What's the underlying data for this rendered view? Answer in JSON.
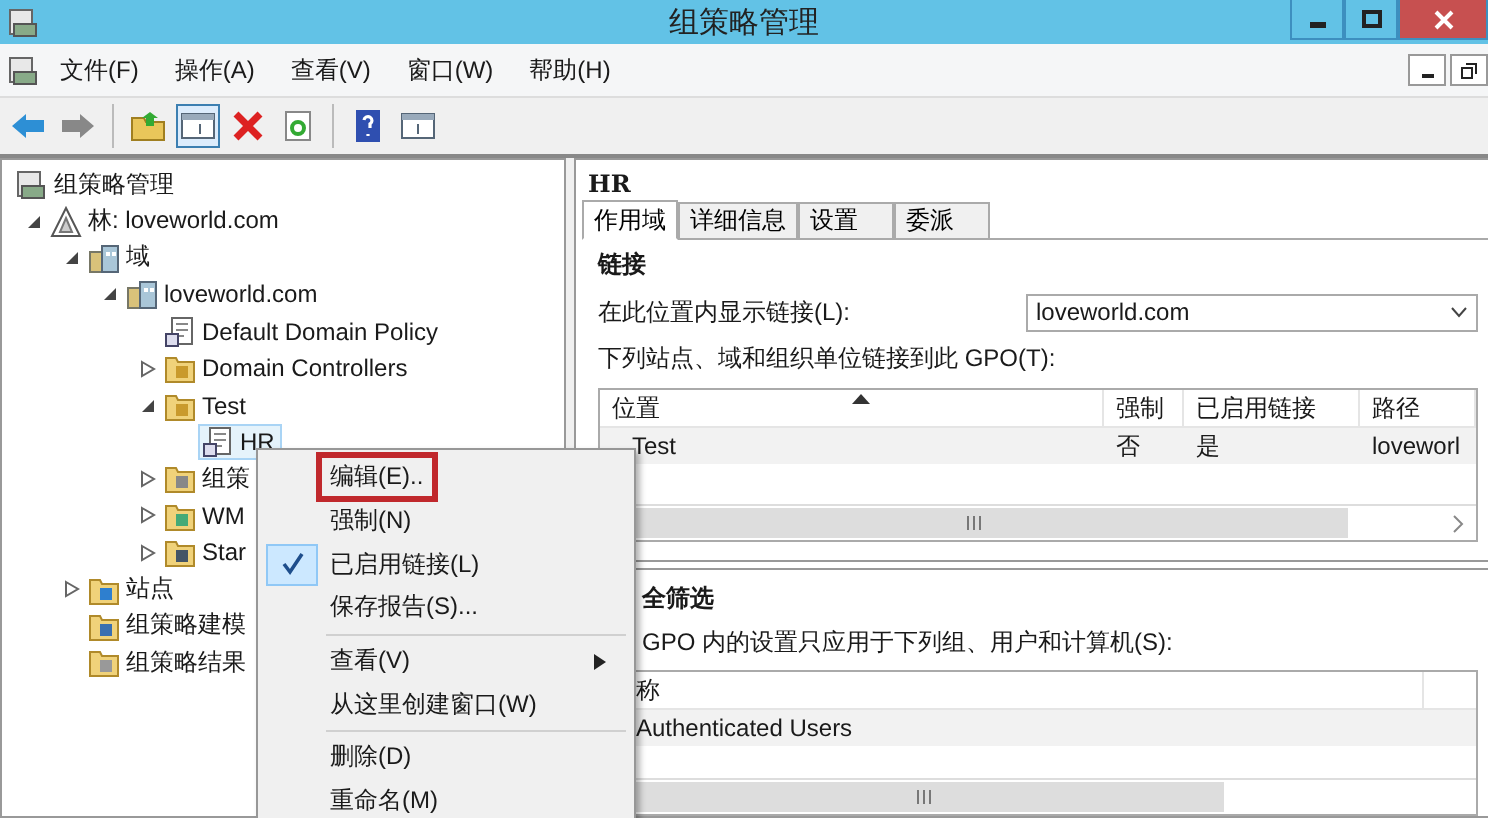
{
  "window": {
    "title": "组策略管理"
  },
  "menu_bar": [
    "文件(F)",
    "操作(A)",
    "查看(V)",
    "窗口(W)",
    "帮助(H)"
  ],
  "toolbar": [
    {
      "kind": "back",
      "pressed": false
    },
    {
      "kind": "forward",
      "pressed": false
    },
    {
      "kind": "separator"
    },
    {
      "kind": "up",
      "pressed": false
    },
    {
      "kind": "tree",
      "pressed": true
    },
    {
      "kind": "delete",
      "pressed": false
    },
    {
      "kind": "refresh",
      "pressed": false
    },
    {
      "kind": "separator"
    },
    {
      "kind": "help",
      "pressed": false
    },
    {
      "kind": "pane",
      "pressed": false
    }
  ],
  "tree": [
    {
      "label": "组策略管理",
      "kind": "console",
      "selected": false,
      "children": [
        {
          "label": "林: loveworld.com",
          "kind": "forest",
          "expanded": true,
          "selected": false,
          "children": [
            {
              "label": "域",
              "kind": "domains",
              "expanded": true,
              "selected": false,
              "children": [
                {
                  "label": "loveworld.com",
                  "kind": "domain",
                  "expanded": true,
                  "selected": false,
                  "children": [
                    {
                      "label": "Default Domain Policy",
                      "kind": "gpo",
                      "selected": false
                    },
                    {
                      "label": "Domain Controllers",
                      "kind": "ou",
                      "expanded": false,
                      "selected": false
                    },
                    {
                      "label": "Test",
                      "kind": "ou",
                      "expanded": true,
                      "selected": false,
                      "children": [
                        {
                          "label": "HR",
                          "kind": "gpo",
                          "selected": true
                        }
                      ]
                    },
                    {
                      "label": "组策",
                      "kind": "gpo-folder",
                      "expanded": false,
                      "selected": false
                    },
                    {
                      "label": "WM",
                      "kind": "filter-folder",
                      "expanded": false,
                      "selected": false
                    },
                    {
                      "label": "Star",
                      "kind": "starter-folder",
                      "expanded": false,
                      "selected": false
                    }
                  ]
                }
              ]
            },
            {
              "label": "站点",
              "kind": "sites",
              "expanded": false,
              "selected": false
            },
            {
              "label": "组策略建模",
              "kind": "modeling",
              "selected": false
            },
            {
              "label": "组策略结果",
              "kind": "results",
              "selected": false
            }
          ]
        }
      ]
    }
  ],
  "details": {
    "title": "HR",
    "tabs": [
      {
        "label": "作用域",
        "selected": true
      },
      {
        "label": "详细信息",
        "selected": false
      },
      {
        "label": "设置",
        "selected": false
      },
      {
        "label": "委派",
        "selected": false
      }
    ],
    "links": {
      "heading": "链接",
      "location_label": "在此位置内显示链接(L):",
      "location": "loveworld.com",
      "table_label": "下列站点、域和组织单位链接到此 GPO(T):",
      "columns": [
        {
          "label": "位置",
          "sorted": true
        },
        {
          "label": "强制",
          "sorted": false
        },
        {
          "label": "已启用链接",
          "sorted": false
        },
        {
          "label": "路径",
          "sorted": false
        }
      ],
      "rows": [
        [
          "Test",
          "否",
          "是",
          "loveworl"
        ]
      ]
    },
    "security_filtering": {
      "heading": "全筛选",
      "description": "GPO 内的设置只应用于下列组、用户和计算机(S):",
      "columns": [
        "称"
      ],
      "rows": [
        [
          "Authenticated Users"
        ]
      ]
    }
  },
  "context_menu": [
    {
      "kind": "item",
      "label": "编辑(E)..",
      "checked": false,
      "submenu": false,
      "highlighted": true
    },
    {
      "kind": "item",
      "label": "强制(N)",
      "checked": false,
      "submenu": false,
      "highlighted": false
    },
    {
      "kind": "item",
      "label": "已启用链接(L)",
      "checked": true,
      "submenu": false,
      "highlighted": false
    },
    {
      "kind": "item",
      "label": "保存报告(S)...",
      "checked": false,
      "submenu": false,
      "highlighted": false
    },
    {
      "kind": "separator"
    },
    {
      "kind": "item",
      "label": "查看(V)",
      "checked": false,
      "submenu": true,
      "highlighted": false
    },
    {
      "kind": "item",
      "label": "从这里创建窗口(W)",
      "checked": false,
      "submenu": false,
      "highlighted": false
    },
    {
      "kind": "separator"
    },
    {
      "kind": "item",
      "label": "删除(D)",
      "checked": false,
      "submenu": false,
      "highlighted": false
    },
    {
      "kind": "item",
      "label": "重命名(M)",
      "checked": false,
      "submenu": false,
      "highlighted": false
    }
  ]
}
